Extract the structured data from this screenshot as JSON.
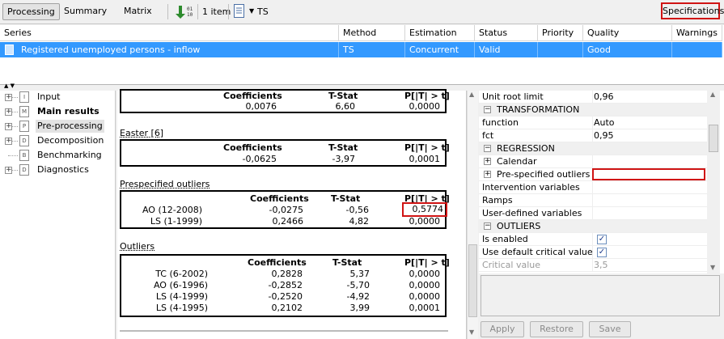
{
  "toolbar": {
    "tabs": [
      "Processing",
      "Summary",
      "Matrix"
    ],
    "item_count": "1 item",
    "method_menu": "TS",
    "specifications": "Specifications"
  },
  "grid": {
    "columns": [
      "Series",
      "Method",
      "Estimation",
      "Status",
      "Priority",
      "Quality",
      "Warnings"
    ],
    "row": {
      "series": "Registered unemployed persons - inflow",
      "method": "TS",
      "estimation": "Concurrent",
      "status": "Valid",
      "priority": "",
      "quality": "Good",
      "warnings": ""
    }
  },
  "tree": [
    {
      "label": "Input",
      "icon": "I"
    },
    {
      "label": "Main results",
      "icon": "M"
    },
    {
      "label": "Pre-processing",
      "icon": "P"
    },
    {
      "label": "Decomposition",
      "icon": "D"
    },
    {
      "label": "Benchmarking",
      "icon": "B"
    },
    {
      "label": "Diagnostics",
      "icon": "D"
    }
  ],
  "results": {
    "top_table": {
      "headers": [
        "Coefficients",
        "T-Stat",
        "P[|T| > t]"
      ],
      "values": [
        "0,0076",
        "6,60",
        "0,0000"
      ]
    },
    "easter": {
      "title": "Easter [6]",
      "headers": [
        "Coefficients",
        "T-Stat",
        "P[|T| > t]"
      ],
      "values": [
        "-0,0625",
        "-3,97",
        "0,0001"
      ]
    },
    "prespecified": {
      "title": "Prespecified outliers",
      "headers": [
        "Coefficients",
        "T-Stat",
        "P[|T| > t]"
      ],
      "rows": [
        {
          "name": "AO (12-2008)",
          "coef": "-0,0275",
          "tstat": "-0,56",
          "p": "0,5774"
        },
        {
          "name": "LS (1-1999)",
          "coef": "0,2466",
          "tstat": "4,82",
          "p": "0,0000"
        }
      ]
    },
    "outliers": {
      "title": "Outliers",
      "headers": [
        "Coefficients",
        "T-Stat",
        "P[|T| > t]"
      ],
      "rows": [
        {
          "name": "TC (6-2002)",
          "coef": "0,2828",
          "tstat": "5,37",
          "p": "0,0000"
        },
        {
          "name": "AO (6-1996)",
          "coef": "-0,2852",
          "tstat": "-5,70",
          "p": "0,0000"
        },
        {
          "name": "LS (4-1999)",
          "coef": "-0,2520",
          "tstat": "-4,92",
          "p": "0,0000"
        },
        {
          "name": "LS (4-1995)",
          "coef": "0,2102",
          "tstat": "3,99",
          "p": "0,0001"
        }
      ]
    }
  },
  "properties": {
    "unit_root_limit": {
      "name": "Unit root limit",
      "value": "0,96"
    },
    "transformation": "TRANSFORMATION",
    "function": {
      "name": "function",
      "value": "Auto"
    },
    "fct": {
      "name": "fct",
      "value": "0,95"
    },
    "regression": "REGRESSION",
    "calendar": "Calendar",
    "prespecified_outliers": "Pre-specified outliers",
    "intervention_variables": "Intervention variables",
    "ramps": "Ramps",
    "user_defined": "User-defined variables",
    "outliers": "OUTLIERS",
    "is_enabled": "Is enabled",
    "use_default_cv": "Use default critical value",
    "critical_value": {
      "name": "Critical value",
      "value": "3,5"
    }
  },
  "buttons": {
    "apply": "Apply",
    "restore": "Restore",
    "save": "Save"
  },
  "colors": {
    "selection": "#3399ff",
    "highlight": "#d01414"
  }
}
